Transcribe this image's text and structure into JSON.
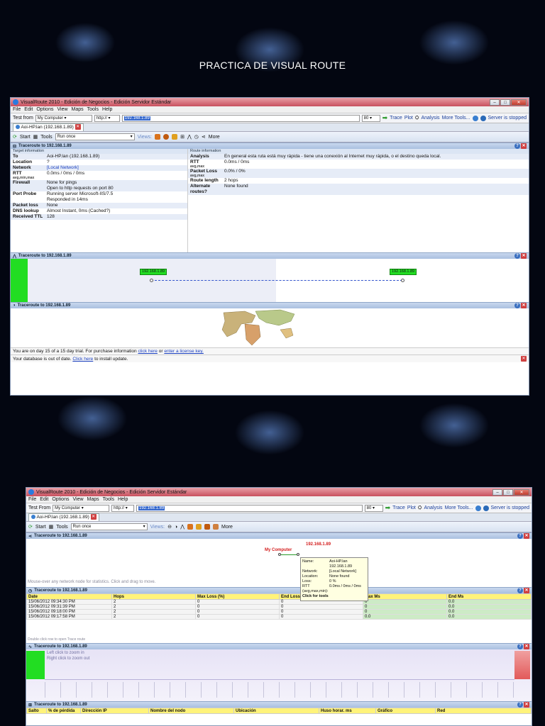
{
  "slide_title": "PRACTICA DE VISUAL ROUTE",
  "colors": {
    "route_green": "#22dd22",
    "header_blue": "#a9bfe0",
    "title_red": "#c8505e",
    "row_yellow": "#fff37a"
  },
  "app": {
    "title": "VisualRoute 2010 - Edición de Negocios - Edición Servidor Estándar",
    "menu": [
      "File",
      "Edit",
      "Options",
      "View",
      "Maps",
      "Tools",
      "Help"
    ],
    "test_from_label": "Test from",
    "test_from_label2": "Test From",
    "test_from_value": "My Computer",
    "protocol": "http://",
    "url_value": "192.168.1.89",
    "port": "80",
    "trace": "Trace",
    "plot": "Plot",
    "analysis": "Analysis",
    "more_tools": "More Tools...",
    "server_status": "Server is stopped",
    "tab_label": "Aoi-HP.lan (192.168.1.89)",
    "start": "Start",
    "tools": "Tools",
    "run_mode": "Run once",
    "views": "Views:",
    "more": "More"
  },
  "win1": {
    "panel_trace": "Traceroute to 192.168.1.89",
    "target_header": "Target information",
    "route_header": "Route information",
    "target": [
      {
        "k": "To",
        "v": "Aoi-HP.lan (192.168.1.89)"
      },
      {
        "k": "Location",
        "v": "?"
      },
      {
        "k": "Network",
        "v": "[Local Network]"
      },
      {
        "k": "RTT",
        "v": "0.0ms / 0ms / 0ms",
        "sub": "avg,min,max"
      },
      {
        "k": "Firewall",
        "v": "None for pings",
        "v2": "Open to http requests on port 80"
      },
      {
        "k": "Port Probe",
        "v": "Running server Microsoft-IIS/7.5",
        "v2": "Responded in 14ms"
      },
      {
        "k": "Packet loss",
        "v": "None"
      },
      {
        "k": "DNS lookup",
        "v": "Almost Instant, 0ms (Cached?)"
      },
      {
        "k": "Received TTL",
        "v": "128"
      }
    ],
    "route": [
      {
        "k": "Analysis",
        "v": "En general esta ruta está muy rápida - tiene una conexión al Internet muy rápida, o el destino queda local."
      },
      {
        "k": "RTT",
        "v": "0.0ms / 0ms",
        "sub": "avg,max"
      },
      {
        "k": "Packet Loss",
        "v": "0.0% / 0%",
        "sub": "avg,max"
      },
      {
        "k": "Route length",
        "v": "2 hops"
      },
      {
        "k": "Alternate routes?",
        "v": "None found"
      }
    ],
    "node_a": "192.168.1.89",
    "node_b": "192.168.1.89",
    "panel_map": "Traceroute to 192.168.1.89",
    "trial_pre": "You are on day 15 of a 15 day trial. For purchase information",
    "trial_link1": "click here",
    "trial_mid": "or",
    "trial_link2": "enter a license key.",
    "db_pre": "Your database is out of date.",
    "db_link": "Click here",
    "db_post": "to install update."
  },
  "win2": {
    "panel_net": "Traceroute to 192.168.1.89",
    "node_ip": "192.168.1.89",
    "node_name": "My Computer",
    "hint": "Mouse-over any network node for statistics. Click and drag to move.",
    "tooltip": [
      {
        "k": "Name:",
        "v": "Aoi-HP.lan"
      },
      {
        "k": "",
        "v": "192.168.1.89"
      },
      {
        "k": "Network:",
        "v": "[Local Network]"
      },
      {
        "k": "Location:",
        "v": "None found"
      },
      {
        "k": "Loss:",
        "v": "0 %"
      },
      {
        "k": "RTT",
        "v": "0.0ms / 0ms / 0ms"
      },
      {
        "k": "(avg,max,min):",
        "v": ""
      }
    ],
    "tooltip_footer": "Click for tools",
    "panel_hist": "Traceroute to 192.168.1.89",
    "columns": [
      "Date",
      "Hops",
      "Max Loss (%)",
      "End Loss",
      "Max Ms",
      "End Ms"
    ],
    "rows": [
      [
        "15/06/2012 09:34:30 PM",
        "2",
        "0",
        "0",
        "0",
        "0.0"
      ],
      [
        "15/06/2012 09:31:39 PM",
        "2",
        "0",
        "0",
        "0",
        "0.0"
      ],
      [
        "15/06/2012 09:18:00 PM",
        "2",
        "0",
        "0",
        "0",
        "0.0"
      ],
      [
        "15/06/2012 09:17:58 PM",
        "2",
        "0",
        "0",
        "0.0",
        "0.0"
      ]
    ],
    "hist_hint": "Double click row to open Trace route",
    "panel_plot": "Traceroute to 192.168.1.89",
    "zoom_in": "Left click to zoom in",
    "zoom_out": "Right click to zoom out",
    "panel_table": "Traceroute to 192.168.1.89",
    "table_cols": [
      "Salto",
      "% de pérdida",
      "Dirección IP",
      "Nombre del nodo",
      "Ubicación",
      "Huso horar. ms",
      "Gráfico",
      "Red"
    ]
  }
}
